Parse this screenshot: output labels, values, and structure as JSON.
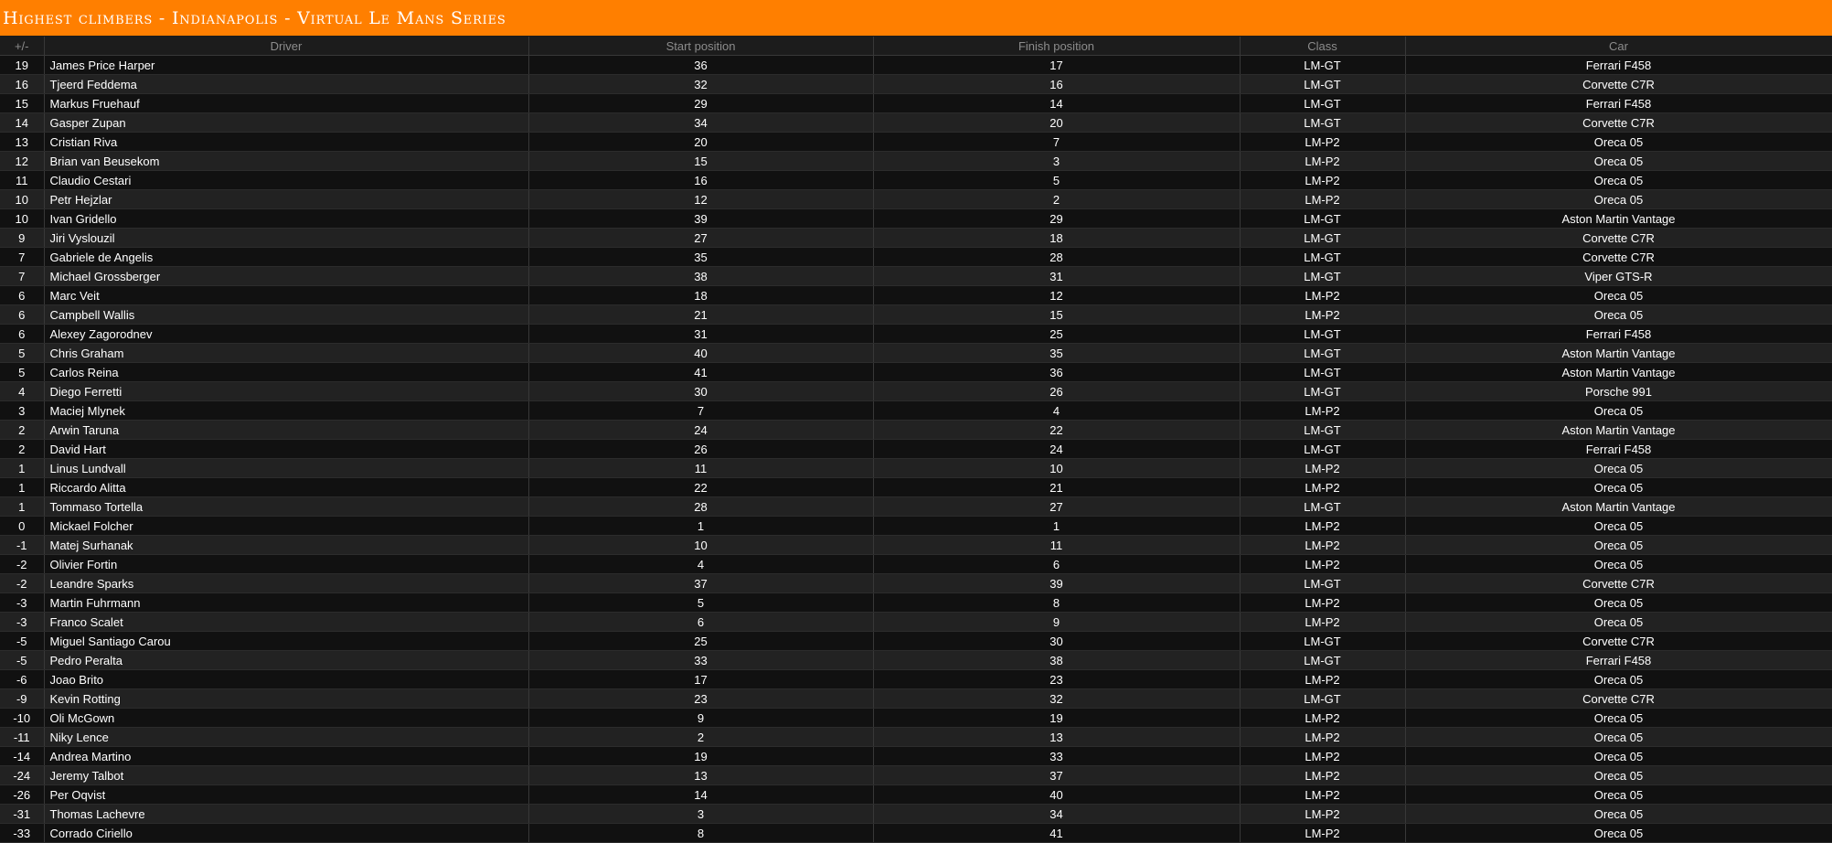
{
  "title": "Highest climbers - Indianapolis - Virtual Le Mans Series",
  "columns": [
    "+/-",
    "Driver",
    "Start position",
    "Finish position",
    "Class",
    "Car"
  ],
  "rows": [
    {
      "diff": "19",
      "driver": "James Price Harper",
      "start": "36",
      "finish": "17",
      "class": "LM-GT",
      "car": "Ferrari F458"
    },
    {
      "diff": "16",
      "driver": "Tjeerd Feddema",
      "start": "32",
      "finish": "16",
      "class": "LM-GT",
      "car": "Corvette C7R"
    },
    {
      "diff": "15",
      "driver": "Markus Fruehauf",
      "start": "29",
      "finish": "14",
      "class": "LM-GT",
      "car": "Ferrari F458"
    },
    {
      "diff": "14",
      "driver": "Gasper Zupan",
      "start": "34",
      "finish": "20",
      "class": "LM-GT",
      "car": "Corvette C7R"
    },
    {
      "diff": "13",
      "driver": "Cristian Riva",
      "start": "20",
      "finish": "7",
      "class": "LM-P2",
      "car": "Oreca 05"
    },
    {
      "diff": "12",
      "driver": "Brian van Beusekom",
      "start": "15",
      "finish": "3",
      "class": "LM-P2",
      "car": "Oreca 05"
    },
    {
      "diff": "11",
      "driver": "Claudio Cestari",
      "start": "16",
      "finish": "5",
      "class": "LM-P2",
      "car": "Oreca 05"
    },
    {
      "diff": "10",
      "driver": "Petr Hejzlar",
      "start": "12",
      "finish": "2",
      "class": "LM-P2",
      "car": "Oreca 05"
    },
    {
      "diff": "10",
      "driver": "Ivan Gridello",
      "start": "39",
      "finish": "29",
      "class": "LM-GT",
      "car": "Aston Martin Vantage"
    },
    {
      "diff": "9",
      "driver": "Jiri Vyslouzil",
      "start": "27",
      "finish": "18",
      "class": "LM-GT",
      "car": "Corvette C7R"
    },
    {
      "diff": "7",
      "driver": "Gabriele de Angelis",
      "start": "35",
      "finish": "28",
      "class": "LM-GT",
      "car": "Corvette C7R"
    },
    {
      "diff": "7",
      "driver": "Michael Grossberger",
      "start": "38",
      "finish": "31",
      "class": "LM-GT",
      "car": "Viper GTS-R"
    },
    {
      "diff": "6",
      "driver": "Marc Veit",
      "start": "18",
      "finish": "12",
      "class": "LM-P2",
      "car": "Oreca 05"
    },
    {
      "diff": "6",
      "driver": "Campbell Wallis",
      "start": "21",
      "finish": "15",
      "class": "LM-P2",
      "car": "Oreca 05"
    },
    {
      "diff": "6",
      "driver": "Alexey Zagorodnev",
      "start": "31",
      "finish": "25",
      "class": "LM-GT",
      "car": "Ferrari F458"
    },
    {
      "diff": "5",
      "driver": "Chris Graham",
      "start": "40",
      "finish": "35",
      "class": "LM-GT",
      "car": "Aston Martin Vantage"
    },
    {
      "diff": "5",
      "driver": "Carlos Reina",
      "start": "41",
      "finish": "36",
      "class": "LM-GT",
      "car": "Aston Martin Vantage"
    },
    {
      "diff": "4",
      "driver": "Diego Ferretti",
      "start": "30",
      "finish": "26",
      "class": "LM-GT",
      "car": "Porsche 991"
    },
    {
      "diff": "3",
      "driver": "Maciej Mlynek",
      "start": "7",
      "finish": "4",
      "class": "LM-P2",
      "car": "Oreca 05"
    },
    {
      "diff": "2",
      "driver": "Arwin Taruna",
      "start": "24",
      "finish": "22",
      "class": "LM-GT",
      "car": "Aston Martin Vantage"
    },
    {
      "diff": "2",
      "driver": "David Hart",
      "start": "26",
      "finish": "24",
      "class": "LM-GT",
      "car": "Ferrari F458"
    },
    {
      "diff": "1",
      "driver": "Linus Lundvall",
      "start": "11",
      "finish": "10",
      "class": "LM-P2",
      "car": "Oreca 05"
    },
    {
      "diff": "1",
      "driver": "Riccardo Alitta",
      "start": "22",
      "finish": "21",
      "class": "LM-P2",
      "car": "Oreca 05"
    },
    {
      "diff": "1",
      "driver": "Tommaso Tortella",
      "start": "28",
      "finish": "27",
      "class": "LM-GT",
      "car": "Aston Martin Vantage"
    },
    {
      "diff": "0",
      "driver": "Mickael Folcher",
      "start": "1",
      "finish": "1",
      "class": "LM-P2",
      "car": "Oreca 05"
    },
    {
      "diff": "-1",
      "driver": "Matej Surhanak",
      "start": "10",
      "finish": "11",
      "class": "LM-P2",
      "car": "Oreca 05"
    },
    {
      "diff": "-2",
      "driver": "Olivier Fortin",
      "start": "4",
      "finish": "6",
      "class": "LM-P2",
      "car": "Oreca 05"
    },
    {
      "diff": "-2",
      "driver": "Leandre Sparks",
      "start": "37",
      "finish": "39",
      "class": "LM-GT",
      "car": "Corvette C7R"
    },
    {
      "diff": "-3",
      "driver": "Martin Fuhrmann",
      "start": "5",
      "finish": "8",
      "class": "LM-P2",
      "car": "Oreca 05"
    },
    {
      "diff": "-3",
      "driver": "Franco Scalet",
      "start": "6",
      "finish": "9",
      "class": "LM-P2",
      "car": "Oreca 05"
    },
    {
      "diff": "-5",
      "driver": "Miguel Santiago Carou",
      "start": "25",
      "finish": "30",
      "class": "LM-GT",
      "car": "Corvette C7R"
    },
    {
      "diff": "-5",
      "driver": "Pedro Peralta",
      "start": "33",
      "finish": "38",
      "class": "LM-GT",
      "car": "Ferrari F458"
    },
    {
      "diff": "-6",
      "driver": "Joao Brito",
      "start": "17",
      "finish": "23",
      "class": "LM-P2",
      "car": "Oreca 05"
    },
    {
      "diff": "-9",
      "driver": "Kevin Rotting",
      "start": "23",
      "finish": "32",
      "class": "LM-GT",
      "car": "Corvette C7R"
    },
    {
      "diff": "-10",
      "driver": "Oli McGown",
      "start": "9",
      "finish": "19",
      "class": "LM-P2",
      "car": "Oreca 05"
    },
    {
      "diff": "-11",
      "driver": "Niky Lence",
      "start": "2",
      "finish": "13",
      "class": "LM-P2",
      "car": "Oreca 05"
    },
    {
      "diff": "-14",
      "driver": "Andrea Martino",
      "start": "19",
      "finish": "33",
      "class": "LM-P2",
      "car": "Oreca 05"
    },
    {
      "diff": "-24",
      "driver": "Jeremy Talbot",
      "start": "13",
      "finish": "37",
      "class": "LM-P2",
      "car": "Oreca 05"
    },
    {
      "diff": "-26",
      "driver": "Per Oqvist",
      "start": "14",
      "finish": "40",
      "class": "LM-P2",
      "car": "Oreca 05"
    },
    {
      "diff": "-31",
      "driver": "Thomas Lachevre",
      "start": "3",
      "finish": "34",
      "class": "LM-P2",
      "car": "Oreca 05"
    },
    {
      "diff": "-33",
      "driver": "Corrado Ciriello",
      "start": "8",
      "finish": "41",
      "class": "LM-P2",
      "car": "Oreca 05"
    }
  ],
  "colors": {
    "title_bar": "#ff7f00",
    "row_odd": "#111111",
    "row_even": "#222222",
    "header_text": "#8c8c8c",
    "text": "#ffffff"
  }
}
